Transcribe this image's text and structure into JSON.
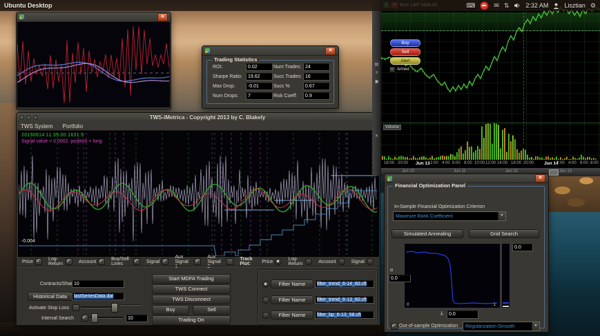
{
  "menubar": {
    "app_label": "Ubuntu Desktop",
    "clock": "2:32 AM",
    "username": "Lisztian"
  },
  "stats": {
    "group_title": "Trading Statistics",
    "fields": [
      {
        "label": "ROI:",
        "value": "0.02"
      },
      {
        "label": "Num Trades:",
        "value": "24"
      },
      {
        "label": "Sharpe Ratio:",
        "value": "19.62"
      },
      {
        "label": "Succ Trades:",
        "value": "16"
      },
      {
        "label": "Max Drop:",
        "value": "-0.01"
      },
      {
        "label": "Succ %",
        "value": "0.67"
      },
      {
        "label": "Num Drops:",
        "value": "7"
      },
      {
        "label": "Risk Coeff:",
        "value": "0.9"
      }
    ]
  },
  "main": {
    "title": "TWS-iMetrica - Copyright 2013 by C. Blakely",
    "menu1": "TWS System",
    "menu2": "Portfolio",
    "info1": "20130614  11:35:00 1631.5",
    "info2": "Signal value = 0.0002. position = long",
    "ylabel": "-0.004",
    "toggles": [
      {
        "label": "Price",
        "checked": true
      },
      {
        "label": "Log-Return",
        "checked": true
      },
      {
        "label": "Account",
        "checked": true
      },
      {
        "label": "Buy/Sell Lines",
        "checked": true
      },
      {
        "label": "Signal",
        "checked": true
      },
      {
        "label": "Aux Signal 1",
        "checked": true
      },
      {
        "label": "Aux Signal 2",
        "checked": false
      }
    ],
    "track": {
      "label": "Track Plot:",
      "options": [
        {
          "label": "Price",
          "selected": true
        },
        {
          "label": "Log-Return",
          "selected": false
        },
        {
          "label": "Account",
          "selected": false
        },
        {
          "label": "Signal",
          "selected": false
        }
      ]
    },
    "controls": {
      "contracts_label": "Contracts/Shares",
      "contracts_value": "10",
      "historical_button": "Historical Data",
      "historical_value": "lastSeriesData.dat",
      "stop_loss_label": "Activate Stop Loss",
      "stop_loss_value": "",
      "interval_label": "Interval Search",
      "interval_value": "10",
      "btn_start": "Start MDFA Trading",
      "btn_connect": "TWS Connect",
      "btn_disconnect": "TWS Disconnect",
      "btn_buy": "Buy",
      "btn_sell": "Sell",
      "btn_trading_on": "Trading On",
      "filter_button": "Filter Name",
      "filters": [
        {
          "value": "filter_trend_6-14_60.cft",
          "selected": true
        },
        {
          "value": "filter_trend_6-13_60.cft",
          "selected": false
        },
        {
          "value": "filter_bp_6-13_58.cft",
          "selected": false
        }
      ]
    }
  },
  "trade": {
    "qty": "1",
    "order": "BUY LMT 1636.25",
    "buy": "Buy",
    "sell": "Sell",
    "alert": "Alert",
    "armed": "Armed",
    "volume_label": "Volume",
    "x_ticks": [
      "18:00",
      "20:00",
      "Jun 13",
      "2:00",
      "4:00",
      "6:00",
      "8:00",
      "10:00",
      "12:00",
      "14:00",
      "18:00",
      "20:00",
      "Jun 14",
      "2:00",
      "4:00",
      "6:00",
      "8:00"
    ],
    "range_labels": [
      "Jun 10",
      "Jun 11",
      "Jun 12",
      "Jun 13"
    ]
  },
  "opt": {
    "group_title": "Financial Optimization Panel",
    "criterion_label": "In-Sample Financial Optimization Criterion",
    "criterion_value": "Maximize Rank Coefficient",
    "btn_annealing": "Simulated Annealing",
    "btn_grid": "Grid Search",
    "top_value": "0.0",
    "alpha_label": "α",
    "alpha_value": "0.0",
    "lambda_label": "λ",
    "lambda_value": "0.0",
    "x0": "0",
    "x1": "1",
    "oos_label": "Out-of-sample Optimization",
    "oos_value": "Regularization-Smooth"
  }
}
